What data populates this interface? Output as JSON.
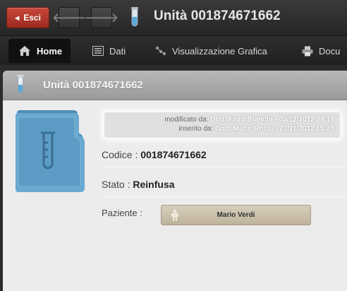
{
  "toolbar": {
    "exit_label": "Esci",
    "title": "Unità 001874671662"
  },
  "tabs": [
    {
      "label": "Home",
      "icon": "home-icon",
      "active": true
    },
    {
      "label": "Dati",
      "icon": "list-icon",
      "active": false
    },
    {
      "label": "Visualizzazione Grafica",
      "icon": "graph-icon",
      "active": false
    },
    {
      "label": "Docu",
      "icon": "printer-icon",
      "active": false
    }
  ],
  "panel": {
    "title": "Unità 001874671662",
    "meta": {
      "modified_prefix": "modificato da:",
      "modified_value": "Dott. Enzo Bianchi - 03/12/2012 09:19",
      "inserted_prefix": "inserito da:",
      "inserted_value": "Dott. Mario Rossi - 27/11/2012 15:28"
    },
    "fields": {
      "codice_label": "Codice :",
      "codice_value": "001874671662",
      "stato_label": "Stato :",
      "stato_value": "Reinfusa",
      "paziente_label": "Paziente :",
      "paziente_value": "Mario Verdi"
    }
  },
  "colors": {
    "exit_button": "#b3362b",
    "tube_liquid": "#5aa7d6",
    "folder": "#5f9cc4",
    "patient_button": "#cdc2ab"
  }
}
